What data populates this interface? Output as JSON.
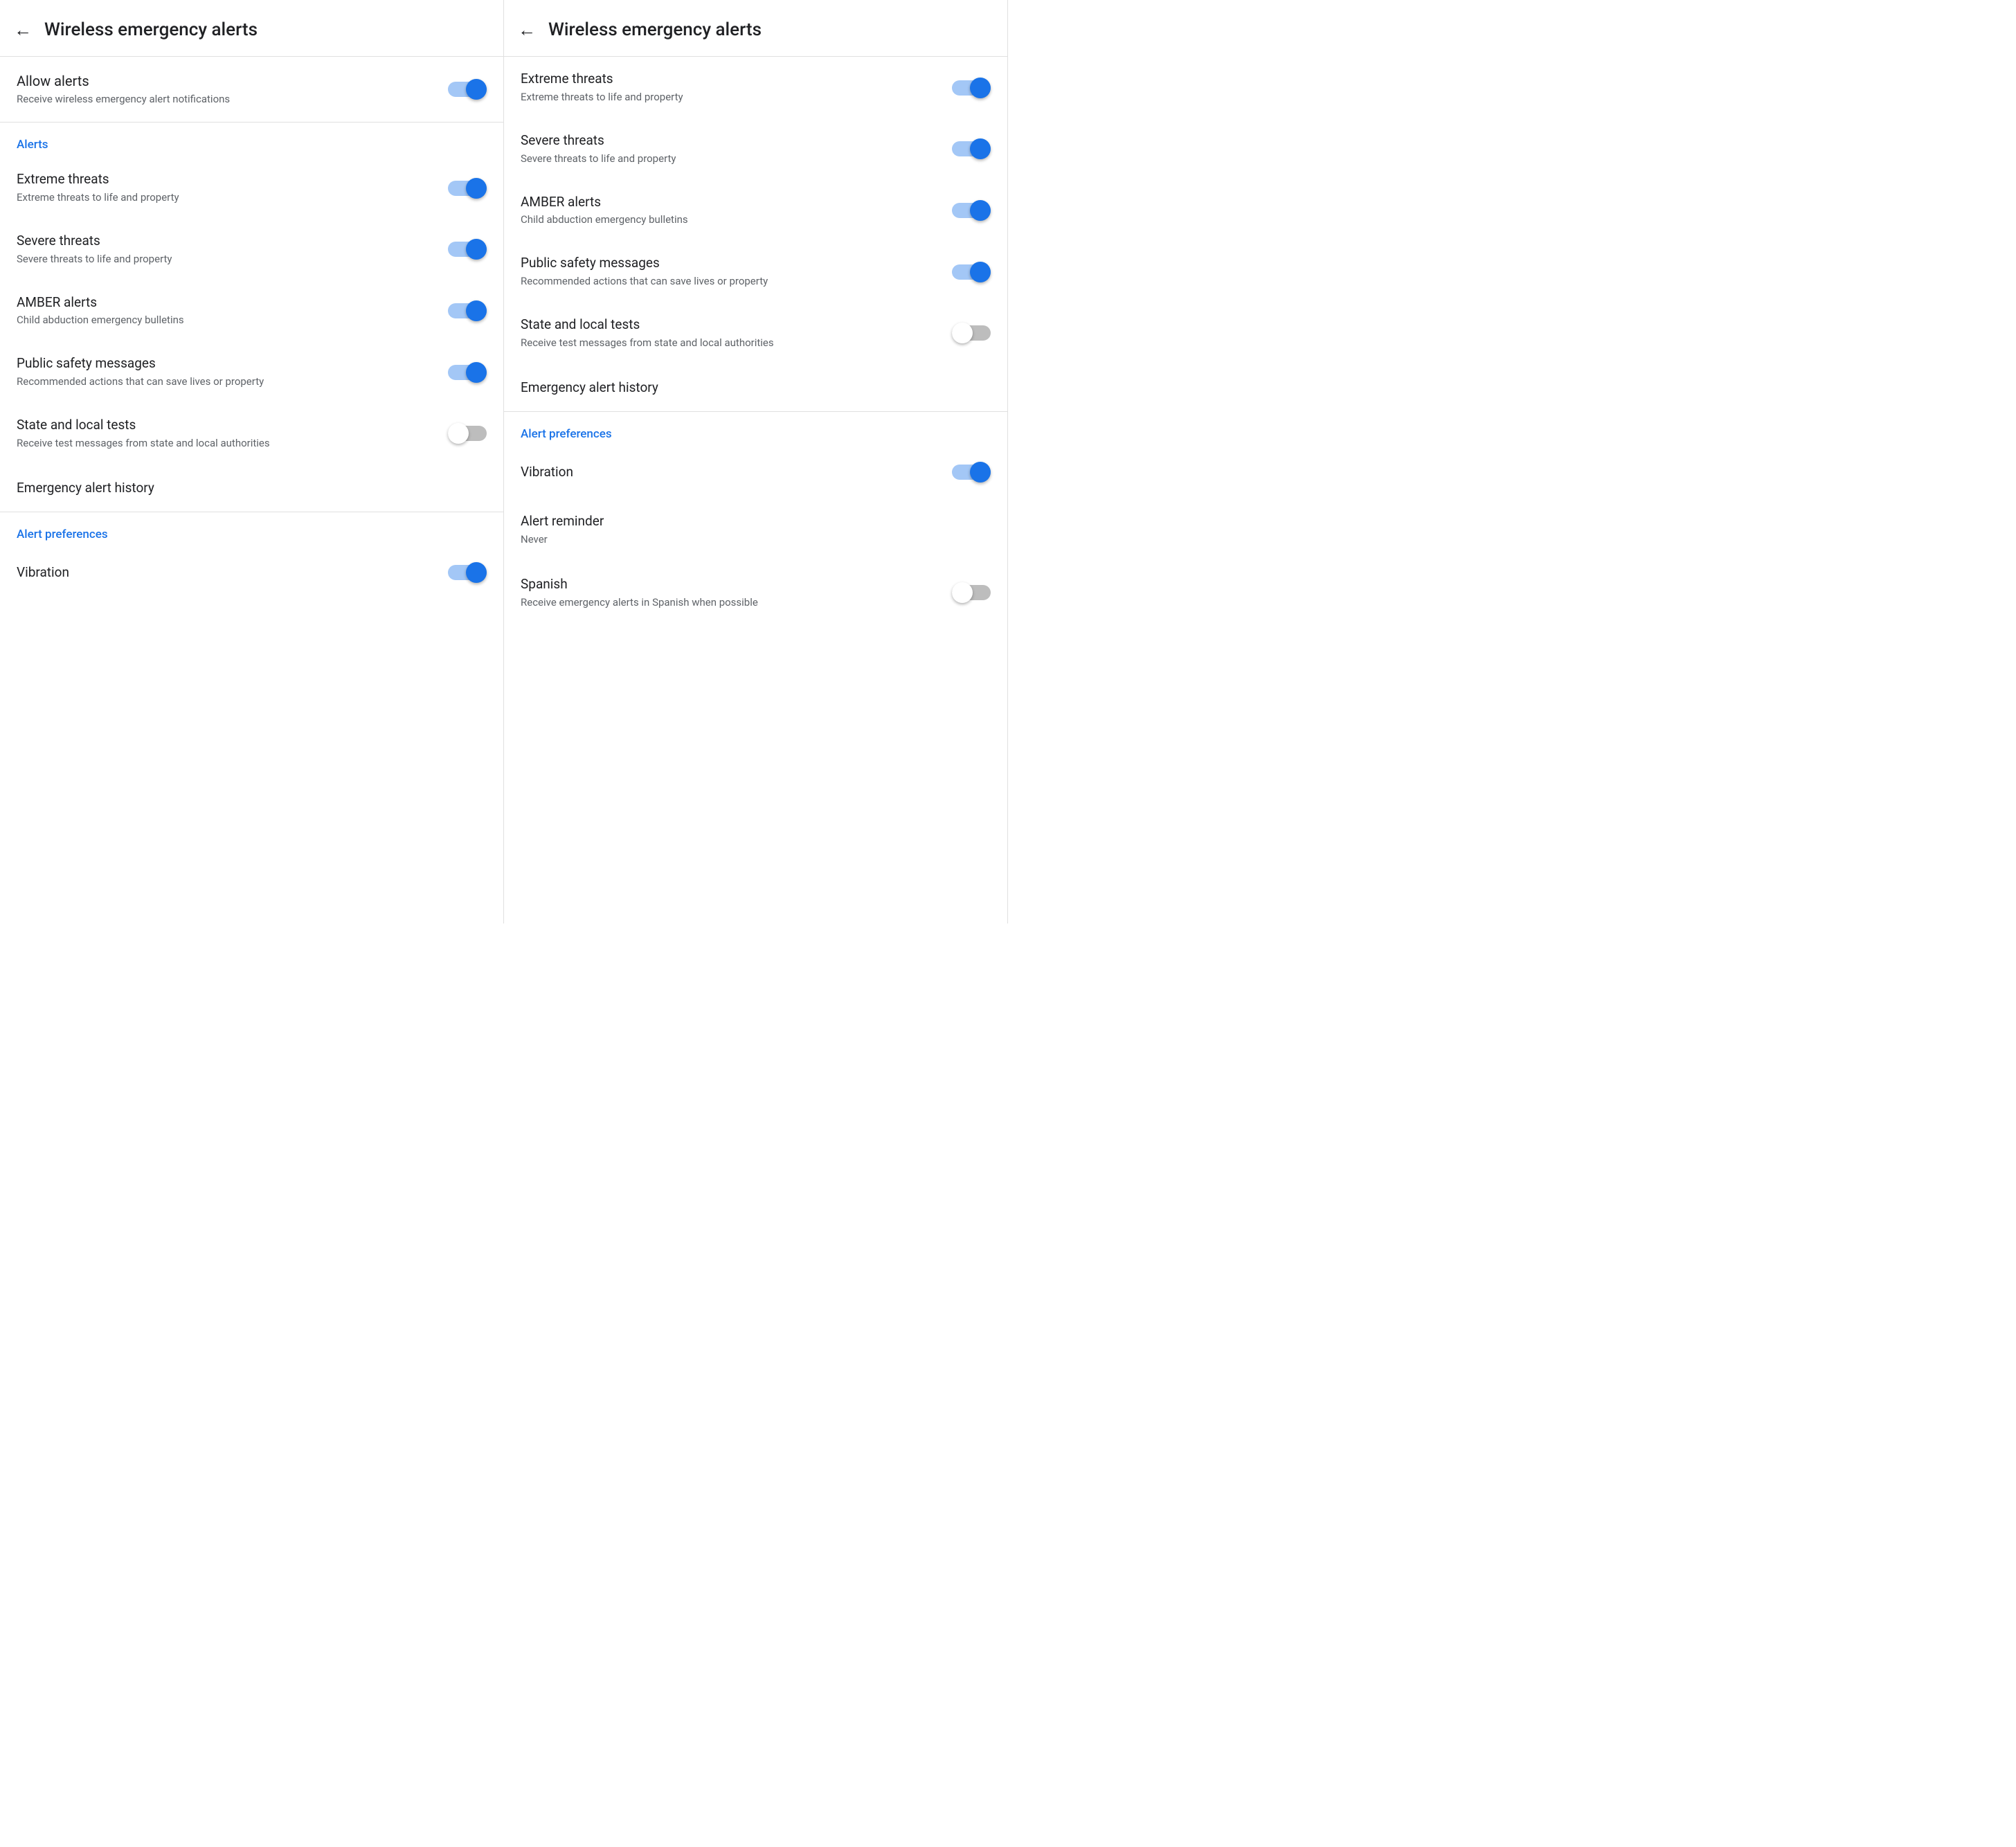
{
  "panel1": {
    "header": {
      "back_label": "←",
      "title": "Wireless emergency alerts"
    },
    "allow_alerts": {
      "title": "Allow alerts",
      "subtitle": "Receive wireless emergency alert notifications",
      "enabled": true
    },
    "alerts_section_label": "Alerts",
    "alerts": [
      {
        "id": "extreme-threats",
        "title": "Extreme threats",
        "subtitle": "Extreme threats to life and property",
        "enabled": true
      },
      {
        "id": "severe-threats",
        "title": "Severe threats",
        "subtitle": "Severe threats to life and property",
        "enabled": true
      },
      {
        "id": "amber-alerts",
        "title": "AMBER alerts",
        "subtitle": "Child abduction emergency bulletins",
        "enabled": true
      },
      {
        "id": "public-safety",
        "title": "Public safety messages",
        "subtitle": "Recommended actions that can save lives or property",
        "enabled": true
      },
      {
        "id": "state-local-tests",
        "title": "State and local tests",
        "subtitle": "Receive test messages from state and local authorities",
        "enabled": false
      }
    ],
    "emergency_history": "Emergency alert history",
    "preferences_section_label": "Alert preferences",
    "vibration": {
      "title": "Vibration",
      "enabled": true
    }
  },
  "panel2": {
    "header": {
      "back_label": "←",
      "title": "Wireless emergency alerts"
    },
    "alerts": [
      {
        "id": "extreme-threats",
        "title": "Extreme threats",
        "subtitle": "Extreme threats to life and property",
        "enabled": true
      },
      {
        "id": "severe-threats",
        "title": "Severe threats",
        "subtitle": "Severe threats to life and property",
        "enabled": true
      },
      {
        "id": "amber-alerts",
        "title": "AMBER alerts",
        "subtitle": "Child abduction emergency bulletins",
        "enabled": true
      },
      {
        "id": "public-safety",
        "title": "Public safety messages",
        "subtitle": "Recommended actions that can save lives or property",
        "enabled": true
      },
      {
        "id": "state-local-tests",
        "title": "State and local tests",
        "subtitle": "Receive test messages from state and local authorities",
        "enabled": false
      }
    ],
    "emergency_history": "Emergency alert history",
    "preferences_section_label": "Alert preferences",
    "vibration": {
      "title": "Vibration",
      "enabled": true
    },
    "alert_reminder": {
      "title": "Alert reminder",
      "value": "Never"
    },
    "spanish": {
      "title": "Spanish",
      "subtitle": "Receive emergency alerts in Spanish when possible",
      "enabled": false
    }
  }
}
